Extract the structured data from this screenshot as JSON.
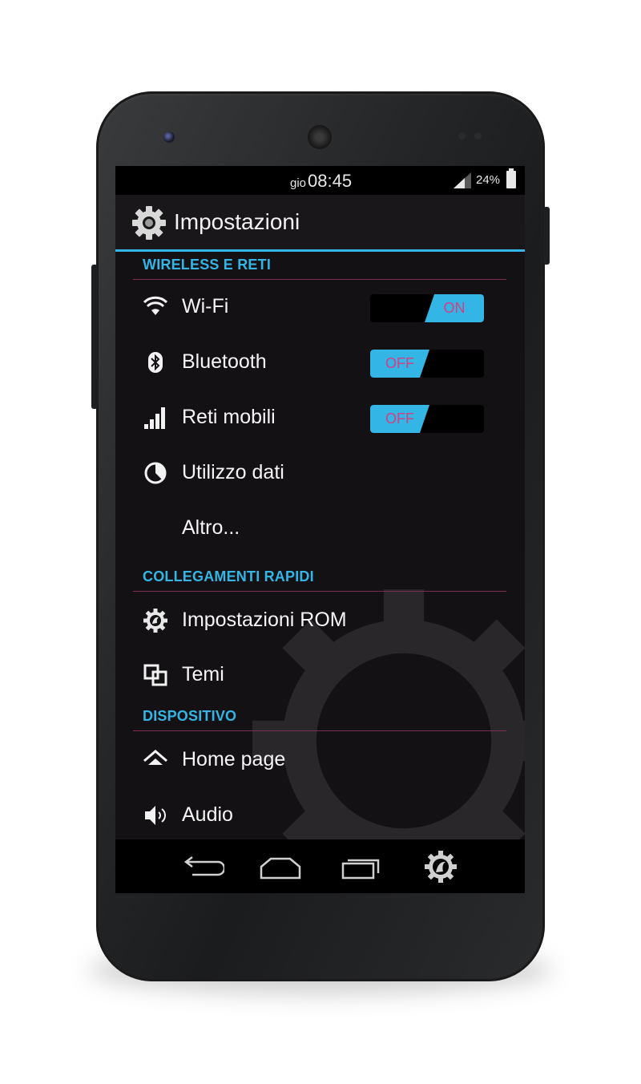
{
  "status_bar": {
    "day": "gio",
    "time": "08:45",
    "battery": "24%"
  },
  "action_bar": {
    "title": "Impostazioni",
    "icon": "gear-icon"
  },
  "sections": {
    "wireless": {
      "header": "WIRELESS E RETI",
      "items": [
        {
          "label": "Wi-Fi",
          "icon": "wifi-icon",
          "toggle": "ON"
        },
        {
          "label": "Bluetooth",
          "icon": "bluetooth-icon",
          "toggle": "OFF"
        },
        {
          "label": "Reti mobili",
          "icon": "signal-icon",
          "toggle": "OFF"
        },
        {
          "label": "Utilizzo dati",
          "icon": "data-usage-icon"
        },
        {
          "label": "Altro..."
        }
      ]
    },
    "shortcuts": {
      "header": "COLLEGAMENTI RAPIDI",
      "items": [
        {
          "label": "Impostazioni ROM",
          "icon": "rom-gear-icon"
        },
        {
          "label": "Temi",
          "icon": "themes-icon"
        }
      ]
    },
    "device": {
      "header": "DISPOSITIVO",
      "items": [
        {
          "label": "Home page",
          "icon": "home-icon"
        },
        {
          "label": "Audio",
          "icon": "speaker-icon"
        }
      ]
    }
  },
  "nav_bar": {
    "buttons": [
      "back-icon",
      "home-nav-icon",
      "recents-icon",
      "rom-logo-icon"
    ]
  },
  "colors": {
    "accent": "#33b5e5",
    "toggle_text": "#d63d83",
    "divider": "#7b2d55",
    "background": "#141114"
  }
}
